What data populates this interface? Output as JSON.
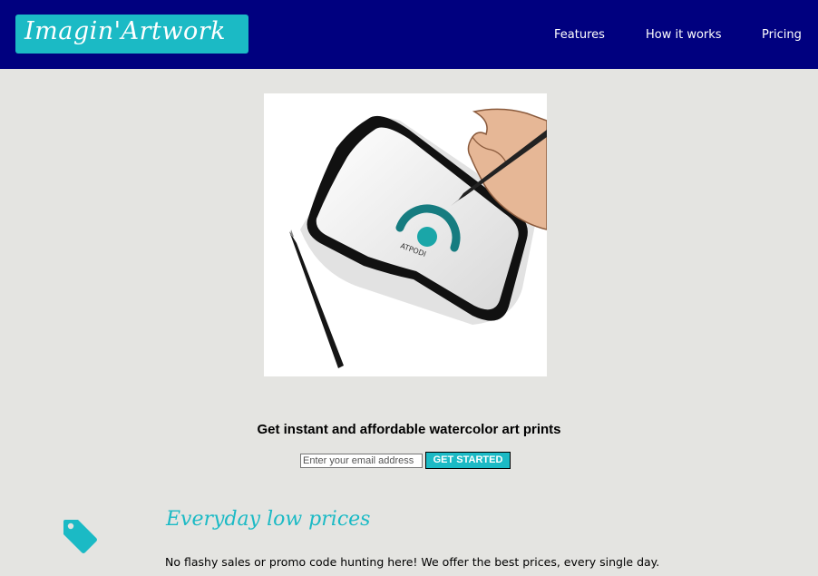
{
  "brand": {
    "logo_text": "Imagin'Artwork",
    "accent_color": "#1bbac5",
    "header_color": "#00007f"
  },
  "nav": {
    "items": [
      {
        "label": "Features"
      },
      {
        "label": "How it works"
      },
      {
        "label": "Pricing"
      }
    ]
  },
  "hero": {
    "image_icon": "hand-drawing-on-tablet-image",
    "tagline": "Get instant and affordable watercolor art prints"
  },
  "signup": {
    "email_placeholder": "Enter your email address",
    "button_label": "GET STARTED"
  },
  "features": [
    {
      "icon": "price-tag-icon",
      "title": "Everyday low prices",
      "text": "No flashy sales or promo code hunting here! We offer the best prices, every single day."
    }
  ]
}
